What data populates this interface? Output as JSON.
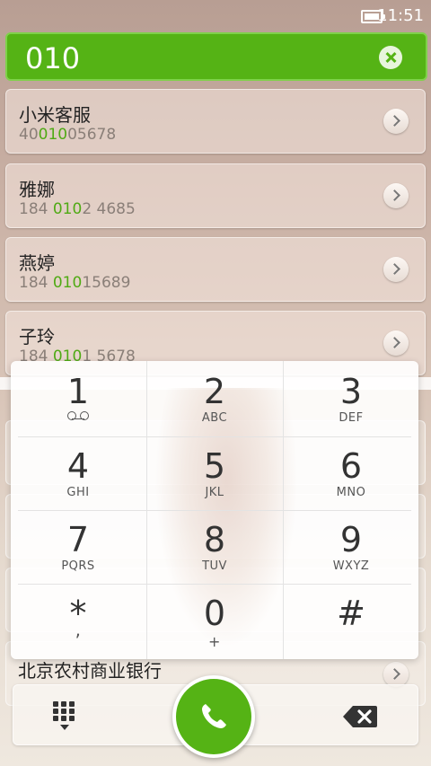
{
  "status_bar": {
    "time": "11:51",
    "battery_icon": "battery-icon"
  },
  "search": {
    "query": "010"
  },
  "contacts": [
    {
      "name": "小米客服",
      "number_parts": [
        "40",
        "010",
        "05678"
      ]
    },
    {
      "name": "雅娜",
      "number_parts": [
        "184 ",
        "010",
        "2 4685"
      ]
    },
    {
      "name": "燕婷",
      "number_parts": [
        "184 ",
        "010",
        "15689"
      ]
    },
    {
      "name": "子玲",
      "number_parts": [
        "184 ",
        "010",
        "1 5678"
      ]
    }
  ],
  "last_contact_name": "北京农村商业银行",
  "dialpad": {
    "keys": [
      {
        "digit": "1",
        "letters": ""
      },
      {
        "digit": "2",
        "letters": "ABC"
      },
      {
        "digit": "3",
        "letters": "DEF"
      },
      {
        "digit": "4",
        "letters": "GHI"
      },
      {
        "digit": "5",
        "letters": "JKL"
      },
      {
        "digit": "6",
        "letters": "MNO"
      },
      {
        "digit": "7",
        "letters": "PQRS"
      },
      {
        "digit": "8",
        "letters": "TUV"
      },
      {
        "digit": "9",
        "letters": "WXYZ"
      },
      {
        "digit": "*",
        "letters": ","
      },
      {
        "digit": "0",
        "letters": "+"
      },
      {
        "digit": "#",
        "letters": ""
      }
    ]
  },
  "colors": {
    "accent": "#55b315",
    "highlight": "#4faa14"
  },
  "icons": {
    "clear": "clear-icon",
    "chevron": "chevron-right-icon",
    "voicemail": "voicemail-icon",
    "dialpad_toggle": "dialpad-icon",
    "call": "phone-icon",
    "backspace": "backspace-icon"
  }
}
